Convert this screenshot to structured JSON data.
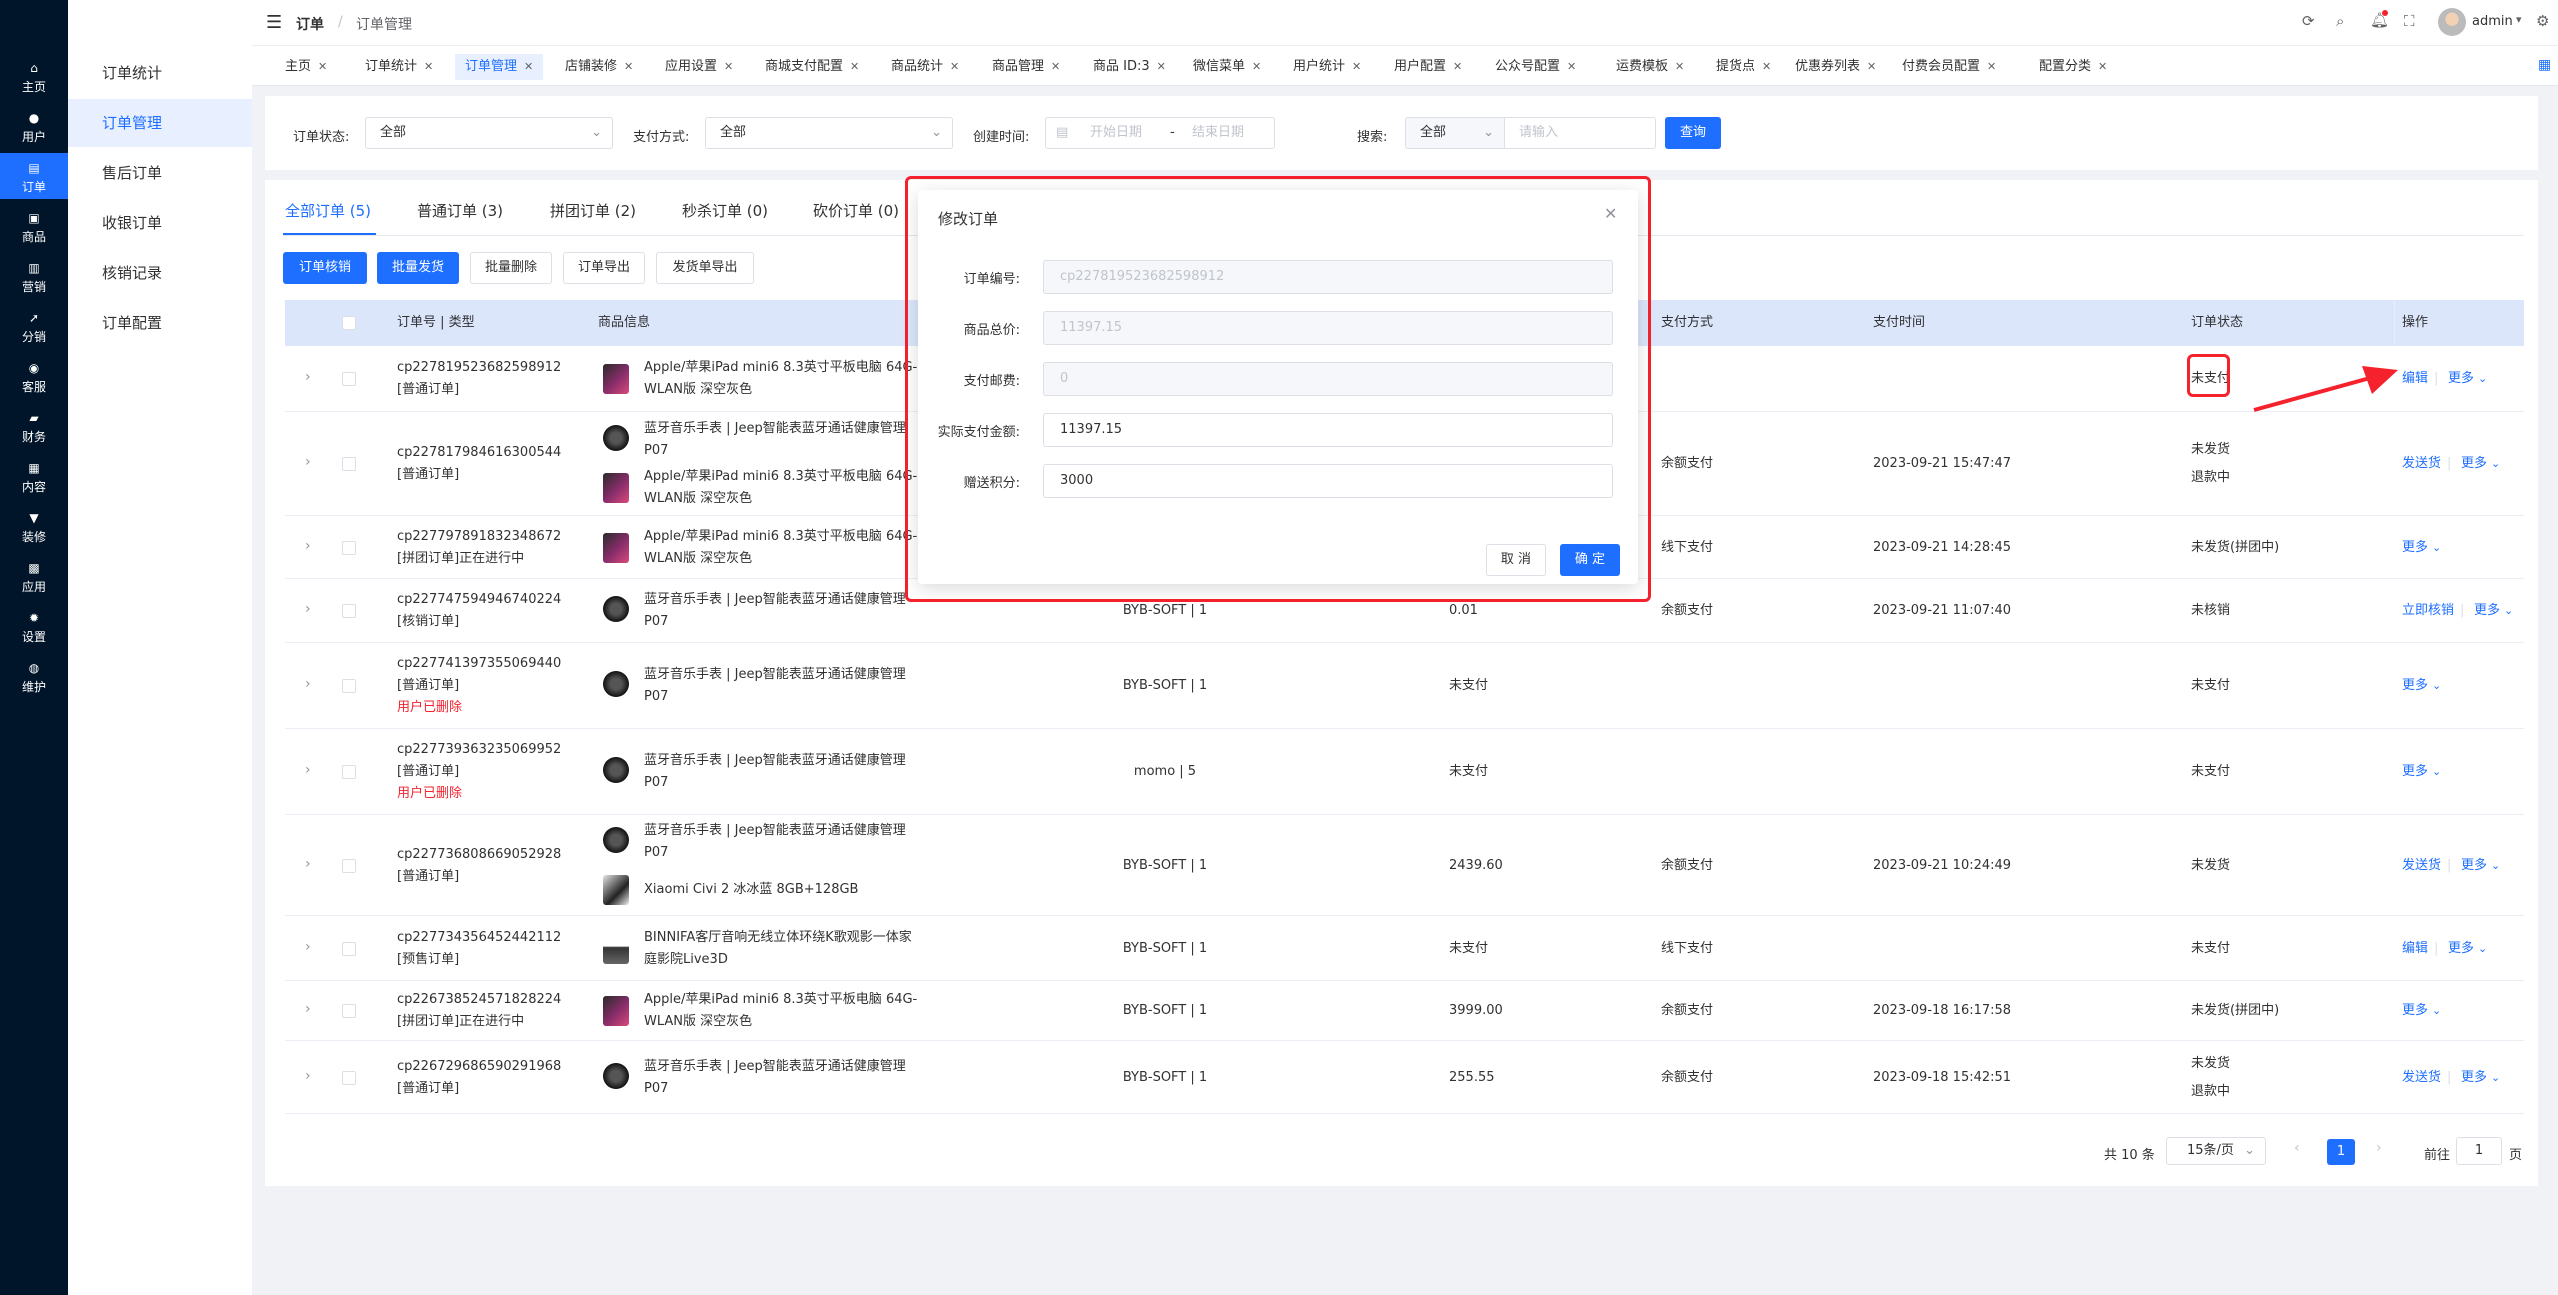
{
  "rail": [
    {
      "icon": "home-icon",
      "label": "主页"
    },
    {
      "icon": "user-icon",
      "label": "用户"
    },
    {
      "icon": "order-icon",
      "label": "订单"
    },
    {
      "icon": "product-icon",
      "label": "商品"
    },
    {
      "icon": "marketing-icon",
      "label": "营销"
    },
    {
      "icon": "distribution-icon",
      "label": "分销"
    },
    {
      "icon": "service-icon",
      "label": "客服"
    },
    {
      "icon": "finance-icon",
      "label": "财务"
    },
    {
      "icon": "content-icon",
      "label": "内容"
    },
    {
      "icon": "decor-icon",
      "label": "装修"
    },
    {
      "icon": "app-icon",
      "label": "应用"
    },
    {
      "icon": "settings-icon",
      "label": "设置"
    },
    {
      "icon": "maintain-icon",
      "label": "维护"
    }
  ],
  "submenu": [
    "订单统计",
    "订单管理",
    "售后订单",
    "收银订单",
    "核销记录",
    "订单配置"
  ],
  "breadcrumb": {
    "root": "订单",
    "sep": "/",
    "current": "订单管理"
  },
  "user": {
    "name": "admin"
  },
  "tabs": [
    "主页",
    "订单统计",
    "订单管理",
    "店铺装修",
    "应用设置",
    "商城支付配置",
    "商品统计",
    "商品管理",
    "商品 ID:3",
    "微信菜单",
    "用户统计",
    "用户配置",
    "公众号配置",
    "运费模板",
    "提货点",
    "优惠券列表",
    "付费会员配置",
    "配置分类"
  ],
  "filters": {
    "status_label": "订单状态:",
    "status_value": "全部",
    "pay_label": "支付方式:",
    "pay_value": "全部",
    "time_label": "创建时间:",
    "start_ph": "开始日期",
    "range_sep": "-",
    "end_ph": "结束日期",
    "search_label": "搜索:",
    "search_scope": "全部",
    "search_ph": "请输入",
    "query_btn": "查询"
  },
  "order_tabs": [
    "全部订单 (5)",
    "普通订单 (3)",
    "拼团订单 (2)",
    "秒杀订单 (0)",
    "砍价订单 (0)"
  ],
  "actions": [
    "订单核销",
    "批量发货",
    "批量删除",
    "订单导出",
    "发货单导出"
  ],
  "columns": {
    "order": "订单号 | 类型",
    "product": "商品信息",
    "pay_method": "支付方式",
    "pay_time": "支付时间",
    "status": "订单状态",
    "ops": "操作"
  },
  "rows": [
    {
      "no": "cp227819523682598912",
      "type": "[普通订单]",
      "note": "",
      "products": [
        {
          "thumb": "ipad",
          "l1": "Apple/苹果iPad mini6 8.3英寸平板电脑 64G-",
          "l2": "WLAN版 深空灰色"
        }
      ],
      "user": "",
      "amount": "",
      "pay": "",
      "time": "",
      "status": [
        "未支付"
      ],
      "ops": [
        "编辑",
        "更多"
      ]
    },
    {
      "no": "cp227817984616300544",
      "type": "[普通订单]",
      "note": "",
      "products": [
        {
          "thumb": "watch",
          "l1": "蓝牙音乐手表 | Jeep智能表蓝牙通话健康管理",
          "l2": "P07"
        },
        {
          "thumb": "ipad",
          "l1": "Apple/苹果iPad mini6 8.3英寸平板电脑 64G-",
          "l2": "WLAN版 深空灰色"
        }
      ],
      "user": "",
      "amount": "",
      "pay": "余额支付",
      "time": "2023-09-21 15:47:47",
      "status": [
        "未发货",
        "退款中"
      ],
      "ops": [
        "发送货",
        "更多"
      ]
    },
    {
      "no": "cp227797891832348672",
      "type": "[拼团订单]正在进行中",
      "note": "",
      "products": [
        {
          "thumb": "ipad",
          "l1": "Apple/苹果iPad mini6 8.3英寸平板电脑 64G-",
          "l2": "WLAN版 深空灰色"
        }
      ],
      "user": "",
      "amount": "",
      "pay": "线下支付",
      "time": "2023-09-21 14:28:45",
      "status": [
        "未发货(拼团中)"
      ],
      "ops": [
        "更多"
      ]
    },
    {
      "no": "cp227747594946740224",
      "type": "[核销订单]",
      "note": "",
      "products": [
        {
          "thumb": "watch",
          "l1": "蓝牙音乐手表 | Jeep智能表蓝牙通话健康管理",
          "l2": "P07"
        }
      ],
      "user": "BYB-SOFT | 1",
      "amount": "0.01",
      "pay": "余额支付",
      "time": "2023-09-21 11:07:40",
      "status": [
        "未核销"
      ],
      "ops": [
        "立即核销",
        "更多"
      ]
    },
    {
      "no": "cp227741397355069440",
      "type": "[普通订单]",
      "note": "用户已删除",
      "products": [
        {
          "thumb": "watch",
          "l1": "蓝牙音乐手表 | Jeep智能表蓝牙通话健康管理",
          "l2": "P07"
        }
      ],
      "user": "BYB-SOFT | 1",
      "amount": "未支付",
      "pay": "",
      "time": "",
      "status": [
        "未支付"
      ],
      "ops": [
        "更多"
      ]
    },
    {
      "no": "cp227739363235069952",
      "type": "[普通订单]",
      "note": "用户已删除",
      "products": [
        {
          "thumb": "watch",
          "l1": "蓝牙音乐手表 | Jeep智能表蓝牙通话健康管理",
          "l2": "P07"
        }
      ],
      "user": "momo | 5",
      "amount": "未支付",
      "pay": "",
      "time": "",
      "status": [
        "未支付"
      ],
      "ops": [
        "更多"
      ]
    },
    {
      "no": "cp227736808669052928",
      "type": "[普通订单]",
      "note": "",
      "products": [
        {
          "thumb": "watch",
          "l1": "蓝牙音乐手表 | Jeep智能表蓝牙通话健康管理",
          "l2": "P07"
        },
        {
          "thumb": "phone",
          "l1": "Xiaomi Civi 2 冰冰蓝 8GB+128GB",
          "l2": ""
        }
      ],
      "user": "BYB-SOFT | 1",
      "amount": "2439.60",
      "pay": "余额支付",
      "time": "2023-09-21 10:24:49",
      "status": [
        "未发货"
      ],
      "ops": [
        "发送货",
        "更多"
      ]
    },
    {
      "no": "cp227734356452442112",
      "type": "[预售订单]",
      "note": "",
      "products": [
        {
          "thumb": "spk",
          "l1": "BINNIFA客厅音响无线立体环绕K歌观影一体家",
          "l2": "庭影院Live3D"
        }
      ],
      "user": "BYB-SOFT | 1",
      "amount": "未支付",
      "pay": "线下支付",
      "time": "",
      "status": [
        "未支付"
      ],
      "ops": [
        "编辑",
        "更多"
      ]
    },
    {
      "no": "cp226738524571828224",
      "type": "[拼团订单]正在进行中",
      "note": "",
      "products": [
        {
          "thumb": "ipad",
          "l1": "Apple/苹果iPad mini6 8.3英寸平板电脑 64G-",
          "l2": "WLAN版 深空灰色"
        }
      ],
      "user": "BYB-SOFT | 1",
      "amount": "3999.00",
      "pay": "余额支付",
      "time": "2023-09-18 16:17:58",
      "status": [
        "未发货(拼团中)"
      ],
      "ops": [
        "更多"
      ]
    },
    {
      "no": "cp226729686590291968",
      "type": "[普通订单]",
      "note": "",
      "products": [
        {
          "thumb": "watch",
          "l1": "蓝牙音乐手表 | Jeep智能表蓝牙通话健康管理",
          "l2": "P07"
        }
      ],
      "user": "BYB-SOFT | 1",
      "amount": "255.55",
      "pay": "余额支付",
      "time": "2023-09-18 15:42:51",
      "status": [
        "未发货",
        "退款中"
      ],
      "ops": [
        "发送货",
        "更多"
      ]
    }
  ],
  "pagination": {
    "total": "共 10 条",
    "per_page": "15条/页",
    "page": "1",
    "goto": "前往",
    "goto_value": "1",
    "page_unit": "页"
  },
  "modal": {
    "title": "修改订单",
    "fields": [
      {
        "label": "订单编号:",
        "value": "cp227819523682598912",
        "disabled": true
      },
      {
        "label": "商品总价:",
        "value": "11397.15",
        "disabled": true
      },
      {
        "label": "支付邮费:",
        "value": "0",
        "disabled": true
      },
      {
        "label": "实际支付金额:",
        "value": "11397.15",
        "disabled": false
      },
      {
        "label": "赠送积分:",
        "value": "3000",
        "disabled": false
      }
    ],
    "cancel": "取 消",
    "ok": "确 定"
  },
  "colors": {
    "primary": "#1e6fff",
    "rail_bg": "#001529",
    "highlight": "#f5222d"
  }
}
